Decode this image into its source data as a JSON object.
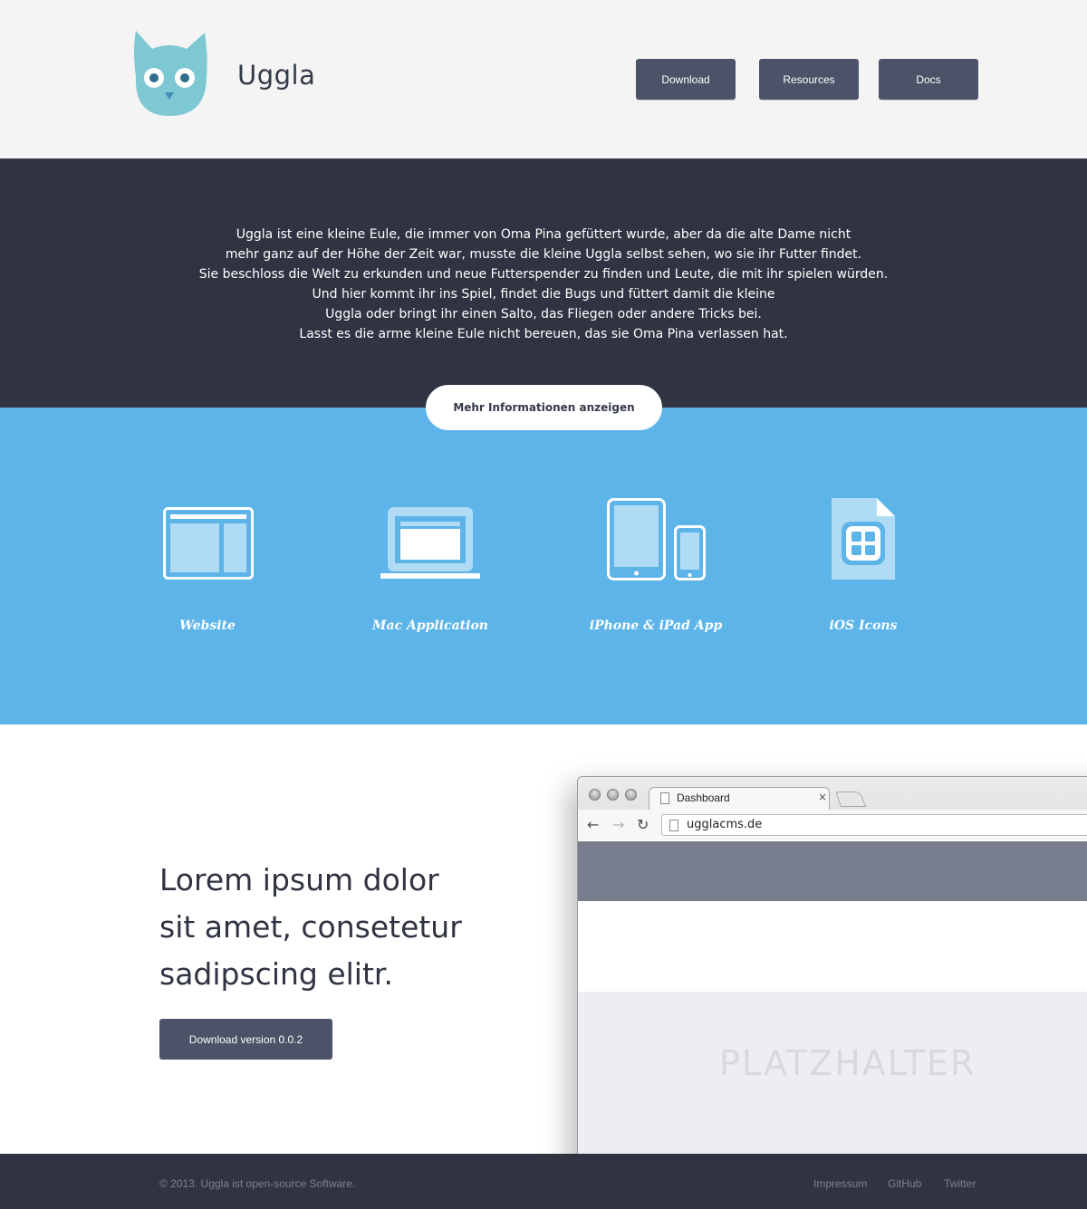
{
  "header": {
    "brand": "Uggla",
    "nav": {
      "download": "Download",
      "resources": "Resources",
      "docs": "Docs"
    },
    "logo_icon": "owl-icon"
  },
  "intro": {
    "lines": [
      "Uggla ist eine kleine Eule, die immer von Oma Pina gefüttert wurde, aber da die alte Dame nicht",
      "mehr ganz auf der Höhe der Zeit war, musste die kleine Uggla selbst sehen, wo sie ihr Futter findet.",
      "Sie beschloss die Welt zu erkunden und neue Futterspender zu finden und Leute, die mit ihr spielen würden.",
      "Und hier kommt ihr ins Spiel, findet die Bugs und füttert damit die kleine",
      "Uggla oder bringt ihr einen Salto, das Fliegen oder andere Tricks bei.",
      "Lasst es die arme kleine Eule nicht bereuen, das sie Oma Pina verlassen hat."
    ],
    "more_button": "Mehr Informationen anzeigen"
  },
  "features": [
    {
      "label": "Website",
      "icon": "website-icon"
    },
    {
      "label": "Mac Application",
      "icon": "laptop-icon"
    },
    {
      "label": "iPhone & iPad App",
      "icon": "devices-icon"
    },
    {
      "label": "iOS Icons",
      "icon": "app-file-icon"
    }
  ],
  "showcase": {
    "headline": [
      "Lorem ipsum dolor",
      "sit amet, consetetur",
      "sadipscing elitr."
    ],
    "download_button": "Download version 0.0.2",
    "browser": {
      "tab_title": "Dashboard",
      "tab_close": "×",
      "url": "ugglacms.de",
      "placeholder": "PLATZHALTER"
    }
  },
  "footer": {
    "copyright": "© 2013. Uggla ist open-source Software.",
    "links": [
      "Impressum",
      "GitHub",
      "Twitter"
    ]
  },
  "colors": {
    "header_bg": "#f4f4f4",
    "dark": "#303342",
    "button": "#4c5268",
    "blue": "#5db4e9",
    "owl": "#7ec8d3"
  }
}
